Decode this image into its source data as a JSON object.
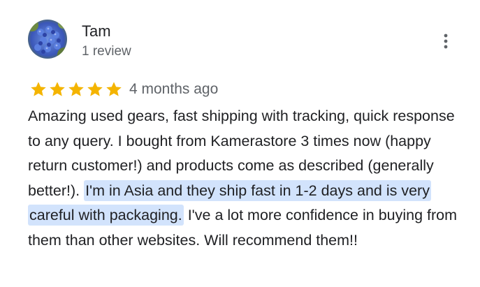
{
  "review": {
    "reviewer": {
      "name": "Tam",
      "review_count": "1 review"
    },
    "rating": {
      "stars": 5,
      "max": 5,
      "star_color": "#f4b400"
    },
    "date": "4 months ago",
    "text_before_highlight": "Amazing used gears, fast shipping with tracking, quick response to any query. I bought from Kamerastore 3 times now (happy return customer!) and products come as described (generally better!). ",
    "text_highlighted": "I'm in Asia and they ship fast in 1-2 days and is very careful with packaging.",
    "text_after_highlight": " I've a lot more confidence in buying from them than other websites. Will recommend them!!",
    "highlight_color": "#d2e3fc"
  }
}
